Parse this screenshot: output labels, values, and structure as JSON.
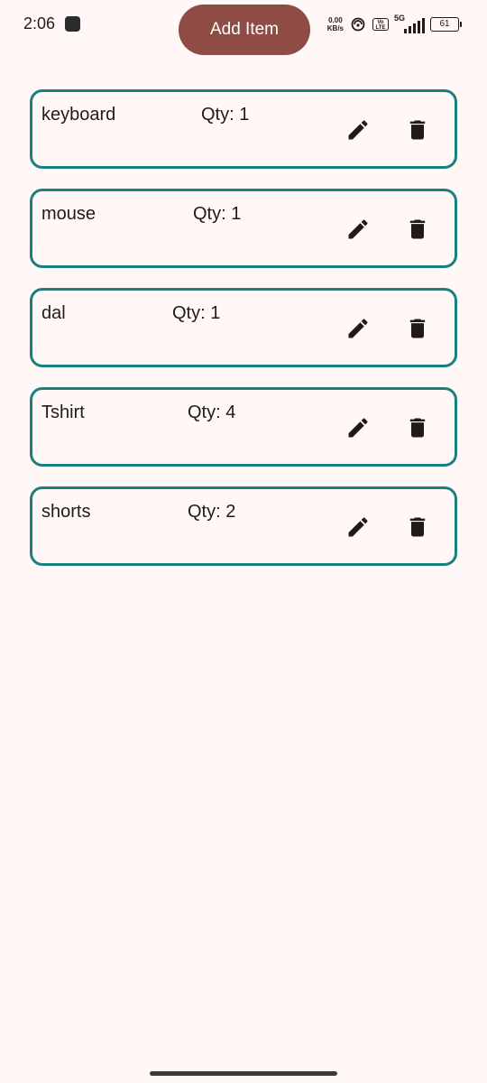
{
  "status_bar": {
    "time": "2:06",
    "net_speed_value": "0.00",
    "net_speed_unit": "KB/s",
    "volte_label": "Vo LTE",
    "network_type": "5G",
    "battery_level": "61"
  },
  "header": {
    "add_button_label": "Add Item"
  },
  "items": [
    {
      "name": "keyboard",
      "qty": "Qty: 1"
    },
    {
      "name": "mouse",
      "qty": "Qty: 1"
    },
    {
      "name": "dal",
      "qty": "Qty: 1"
    },
    {
      "name": "Tshirt",
      "qty": "Qty: 4"
    },
    {
      "name": "shorts",
      "qty": "Qty: 2"
    }
  ],
  "icons": {
    "edit": "pencil-icon",
    "delete": "trash-icon"
  },
  "colors": {
    "background": "#fff8f6",
    "accent_button": "#8e4c44",
    "card_border": "#1b7f7e",
    "text": "#201a19"
  }
}
